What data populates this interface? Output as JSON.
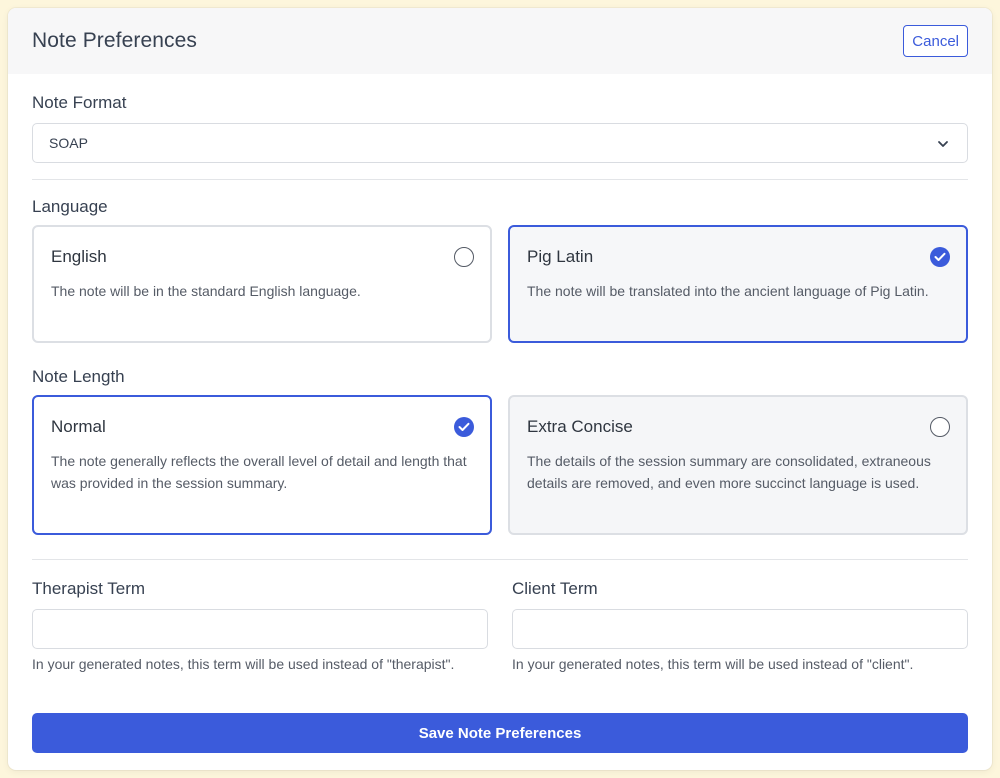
{
  "header": {
    "title": "Note Preferences",
    "cancel_label": "Cancel"
  },
  "note_format": {
    "label": "Note Format",
    "selected_value": "SOAP"
  },
  "language": {
    "label": "Language",
    "options": [
      {
        "title": "English",
        "description": "The note will be in the standard English language.",
        "selected": false
      },
      {
        "title": "Pig Latin",
        "description": "The note will be translated into the ancient language of Pig Latin.",
        "selected": true
      }
    ]
  },
  "note_length": {
    "label": "Note Length",
    "options": [
      {
        "title": "Normal",
        "description": "The note generally reflects the overall level of detail and length that was provided in the session summary.",
        "selected": true
      },
      {
        "title": "Extra Concise",
        "description": "The details of the session summary are consolidated, extraneous details are removed, and even more succinct language is used.",
        "selected": false
      }
    ]
  },
  "terms": {
    "therapist": {
      "label": "Therapist Term",
      "value": "",
      "help": "In your generated notes, this term will be used instead of \"therapist\"."
    },
    "client": {
      "label": "Client Term",
      "value": "",
      "help": "In your generated notes, this term will be used instead of \"client\"."
    }
  },
  "save_label": "Save Note Preferences",
  "colors": {
    "accent": "#3b5bdb",
    "page_background": "#fdf6dc",
    "header_background": "#f7f7f8"
  }
}
